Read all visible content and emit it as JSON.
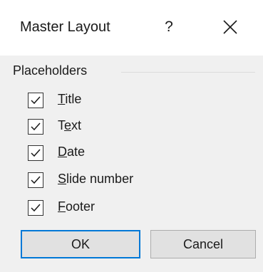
{
  "dialog": {
    "title": "Master Layout",
    "help_label": "?"
  },
  "group": {
    "label": "Placeholders"
  },
  "checkboxes": [
    {
      "key": "",
      "first": "",
      "mnemonic": "T",
      "rest": "itle",
      "checked": true
    },
    {
      "key": "",
      "first": "T",
      "mnemonic": "e",
      "rest": "xt",
      "checked": true
    },
    {
      "key": "",
      "first": "",
      "mnemonic": "D",
      "rest": "ate",
      "checked": true
    },
    {
      "key": "",
      "first": "",
      "mnemonic": "S",
      "rest": "lide number",
      "checked": true
    },
    {
      "key": "",
      "first": "",
      "mnemonic": "F",
      "rest": "ooter",
      "checked": true
    }
  ],
  "buttons": {
    "ok_label": "OK",
    "cancel_label": "Cancel"
  },
  "colors": {
    "default_button_border": "#0078d7",
    "dialog_background": "#f0f0f0",
    "titlebar_background": "#ffffff"
  },
  "icons": {
    "close": "close-icon",
    "check": "checkmark-icon"
  }
}
